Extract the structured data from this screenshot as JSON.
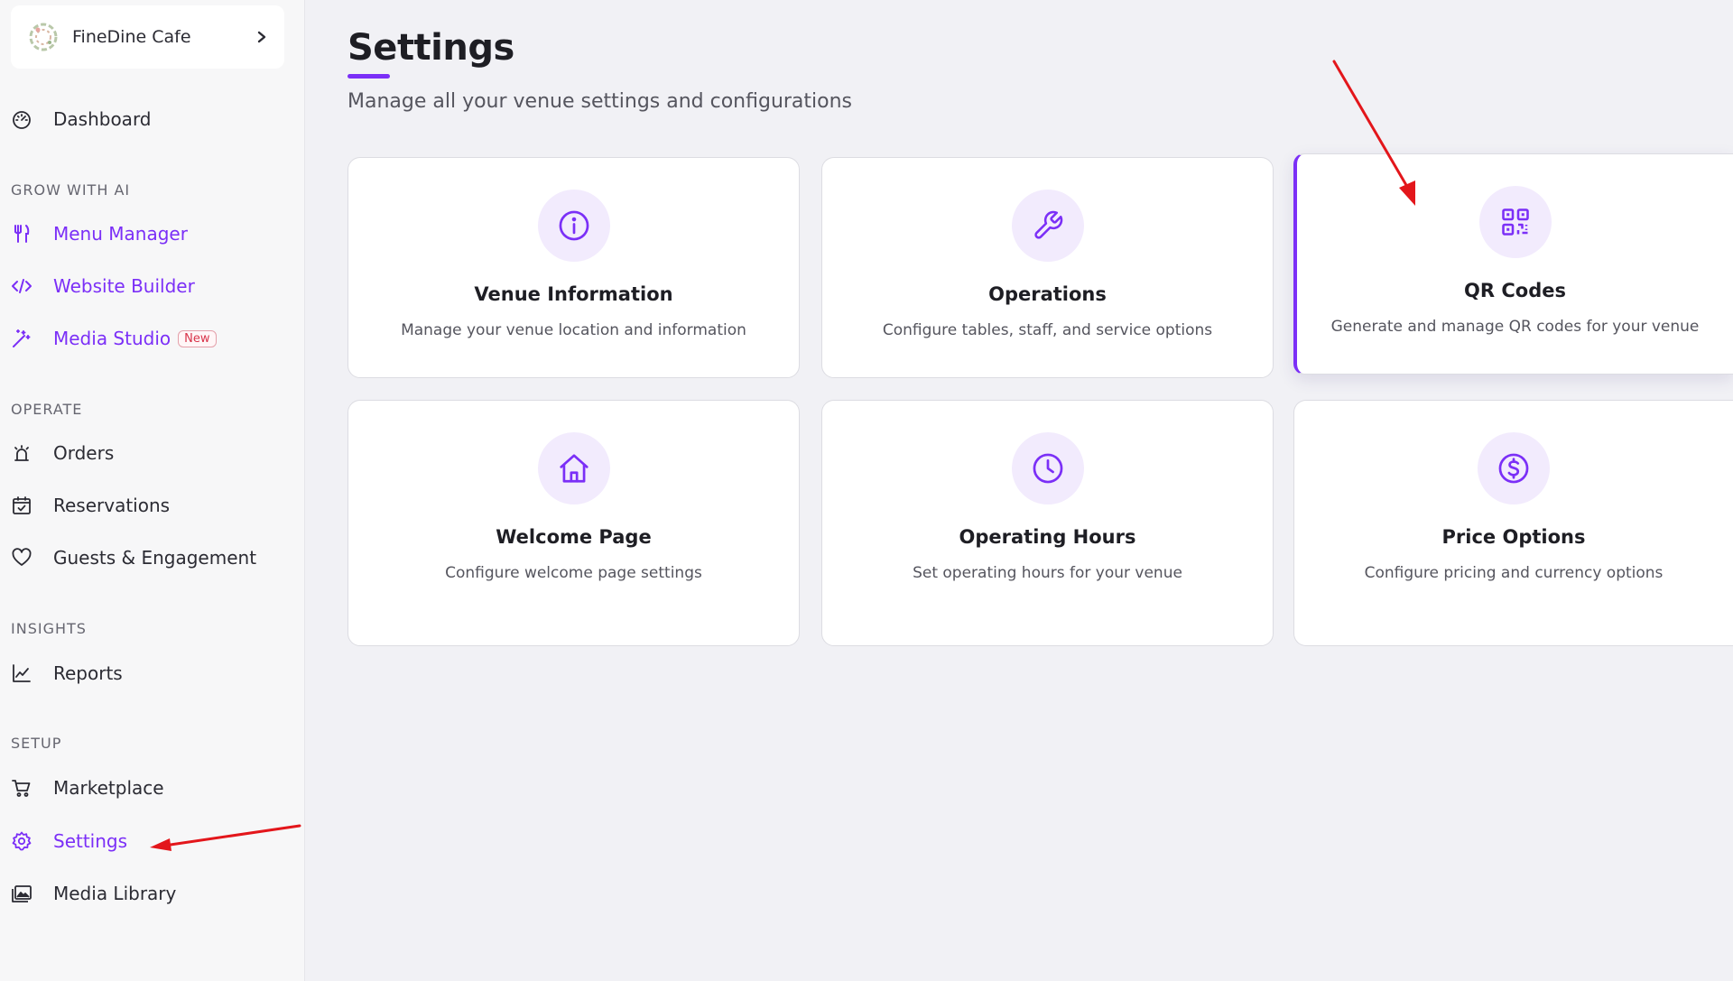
{
  "venue": {
    "name": "FineDine Cafe"
  },
  "sidebar": {
    "dashboard": "Dashboard",
    "sections": {
      "grow": "GROW WITH AI",
      "operate": "OPERATE",
      "insights": "INSIGHTS",
      "setup": "SETUP"
    },
    "grow_items": [
      "Menu Manager",
      "Website Builder",
      "Media Studio"
    ],
    "new_badge": "New",
    "operate_items": [
      "Orders",
      "Reservations",
      "Guests & Engagement"
    ],
    "insights_items": [
      "Reports"
    ],
    "setup_items": [
      "Marketplace",
      "Settings",
      "Media Library"
    ],
    "active_item": "Settings"
  },
  "main": {
    "title": "Settings",
    "subtitle": "Manage all your venue settings and configurations",
    "cards": [
      {
        "title": "Venue Information",
        "description": "Manage your venue location and information",
        "icon": "info-icon"
      },
      {
        "title": "Operations",
        "description": "Configure tables, staff, and service options",
        "icon": "wrench-icon"
      },
      {
        "title": "QR Codes",
        "description": "Generate and manage QR codes for your venue",
        "icon": "qr-code-icon"
      },
      {
        "title": "Welcome Page",
        "description": "Configure welcome page settings",
        "icon": "home-icon"
      },
      {
        "title": "Operating Hours",
        "description": "Set operating hours for your venue",
        "icon": "clock-icon"
      },
      {
        "title": "Price Options",
        "description": "Configure pricing and currency options",
        "icon": "dollar-circle-icon"
      }
    ]
  },
  "colors": {
    "accent": "#7b2ff7",
    "accent_light": "#f2ebfd",
    "annotation_arrow": "#e3161b",
    "page_bg": "#f1f1f5",
    "sidebar_bg": "#f7f7f8"
  }
}
